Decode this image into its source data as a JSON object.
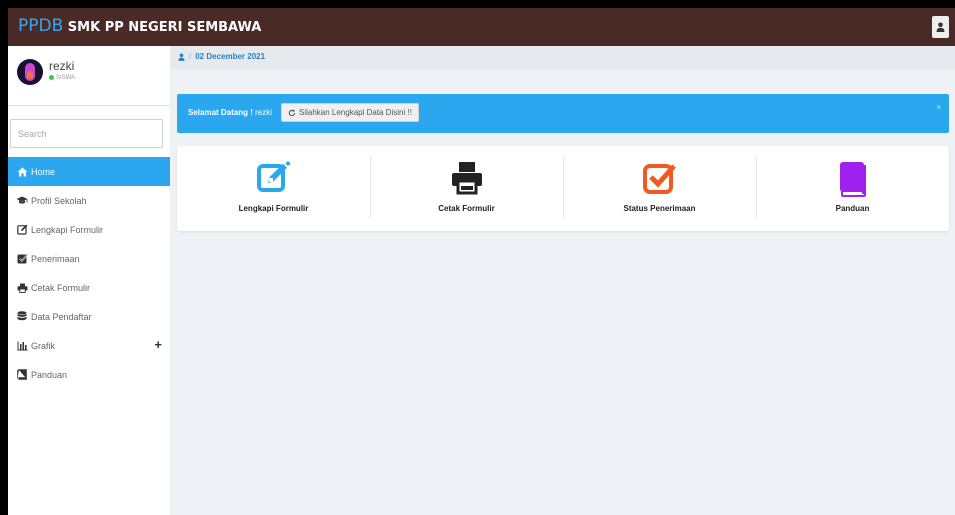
{
  "header": {
    "brand_primary": "PPDB",
    "brand_secondary": "SMK PP NEGERI SEMBAWA",
    "user_icon": "user-icon"
  },
  "profile": {
    "name": "rezki",
    "status": "SISWA"
  },
  "search": {
    "placeholder": "Search"
  },
  "sidebar": {
    "items": [
      {
        "label": "Home",
        "icon": "home-icon",
        "active": true
      },
      {
        "label": "Profil Sekolah",
        "icon": "graduation-cap-icon"
      },
      {
        "label": "Lengkapi Formulir",
        "icon": "edit-icon"
      },
      {
        "label": "Penerimaan",
        "icon": "check-square-icon"
      },
      {
        "label": "Cetak Formulir",
        "icon": "print-icon"
      },
      {
        "label": "Data Pendaftar",
        "icon": "database-icon"
      },
      {
        "label": "Grafik",
        "icon": "bar-chart-icon",
        "expand": "+"
      },
      {
        "label": "Panduan",
        "icon": "book-icon"
      }
    ]
  },
  "breadcrumb": {
    "date": "02 December 2021"
  },
  "alert": {
    "greeting": "Selamat Datang !",
    "user": "rezki",
    "button_label": "Silahkan Lengkapi Data Disini !!",
    "close": "×"
  },
  "cards": [
    {
      "label": "Lengkapi Formulir",
      "icon": "edit-icon",
      "color": "#2ba7f0"
    },
    {
      "label": "Cetak Formulir",
      "icon": "print-icon",
      "color": "#222222"
    },
    {
      "label": "Status Penerimaan",
      "icon": "check-square-icon",
      "color": "#f05a1e"
    },
    {
      "label": "Panduan",
      "icon": "book-icon",
      "color": "#a020f0"
    }
  ],
  "colors": {
    "topbar": "#4a2a26",
    "accent": "#2ba7f0",
    "brand": "#35a7f0"
  }
}
